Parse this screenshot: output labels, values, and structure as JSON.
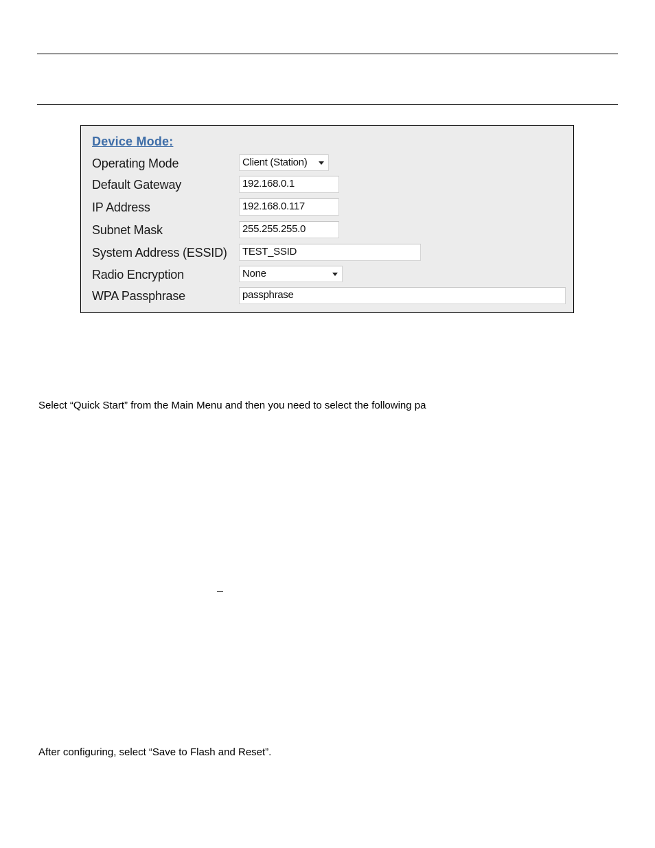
{
  "panel": {
    "title": "Device Mode:",
    "fields": [
      {
        "label": "Operating Mode",
        "type": "select",
        "value": "Client (Station)"
      },
      {
        "label": "Default Gateway",
        "type": "text",
        "value": "192.168.0.1"
      },
      {
        "label": "IP Address",
        "type": "text",
        "value": "192.168.0.117"
      },
      {
        "label": "Subnet Mask",
        "type": "text",
        "value": "255.255.255.0"
      },
      {
        "label": "System Address (ESSID)",
        "type": "text",
        "value": "TEST_SSID"
      },
      {
        "label": "Radio Encryption",
        "type": "select",
        "value": "None"
      },
      {
        "label": "WPA Passphrase",
        "type": "text",
        "value": "passphrase"
      }
    ]
  },
  "body_text": {
    "instruction": "Select “Quick Start” from the Main Menu and then you need to select the following pa",
    "closing": "After configuring, select “Save to Flash and Reset”."
  }
}
